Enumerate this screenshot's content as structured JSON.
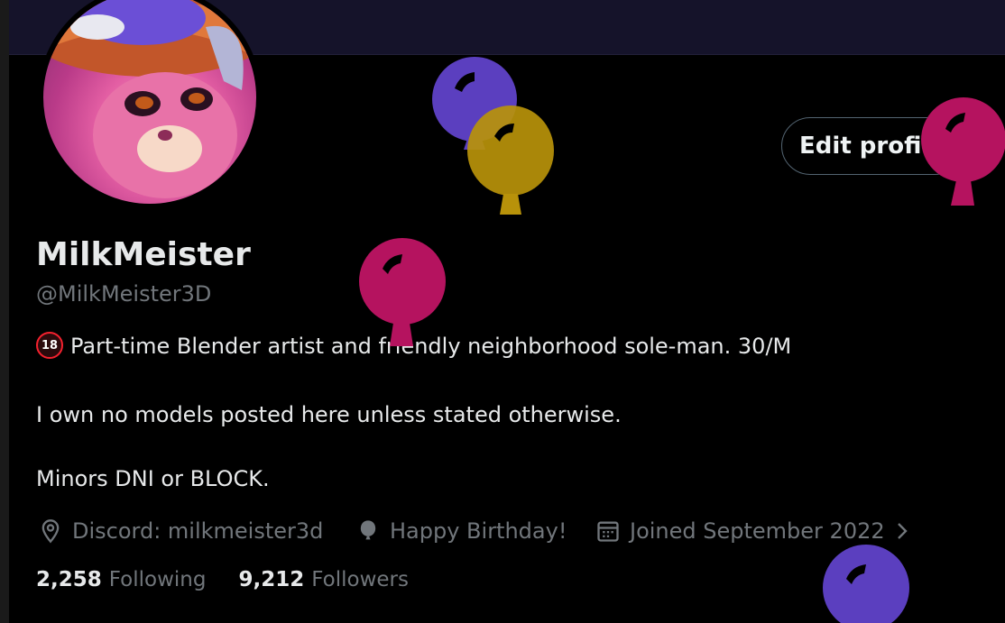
{
  "profile": {
    "display_name": "MilkMeister",
    "handle": "@MilkMeister3D",
    "edit_button": "Edit profile",
    "bio": {
      "line1_badge": "18",
      "line1": "Part-time Blender artist and friendly neighborhood sole-man. 30/M",
      "line2": "I own no models posted here unless stated otherwise.",
      "line3": "Minors DNI or BLOCK."
    },
    "meta": {
      "location_icon": "location-pin-icon",
      "location": "Discord: milkmeister3d",
      "birthday_icon": "balloon-icon",
      "birthday": "Happy Birthday!",
      "joined_icon": "calendar-icon",
      "joined": "Joined September 2022"
    },
    "stats": {
      "following_count": "2,258",
      "following_label": "Following",
      "followers_count": "9,212",
      "followers_label": "Followers"
    }
  },
  "colors": {
    "accent_balloon_purple": "#5b3fbf",
    "accent_balloon_gold": "#b8920a",
    "accent_balloon_pink": "#b5135f",
    "background": "#000000",
    "secondary_text": "#71767b"
  }
}
